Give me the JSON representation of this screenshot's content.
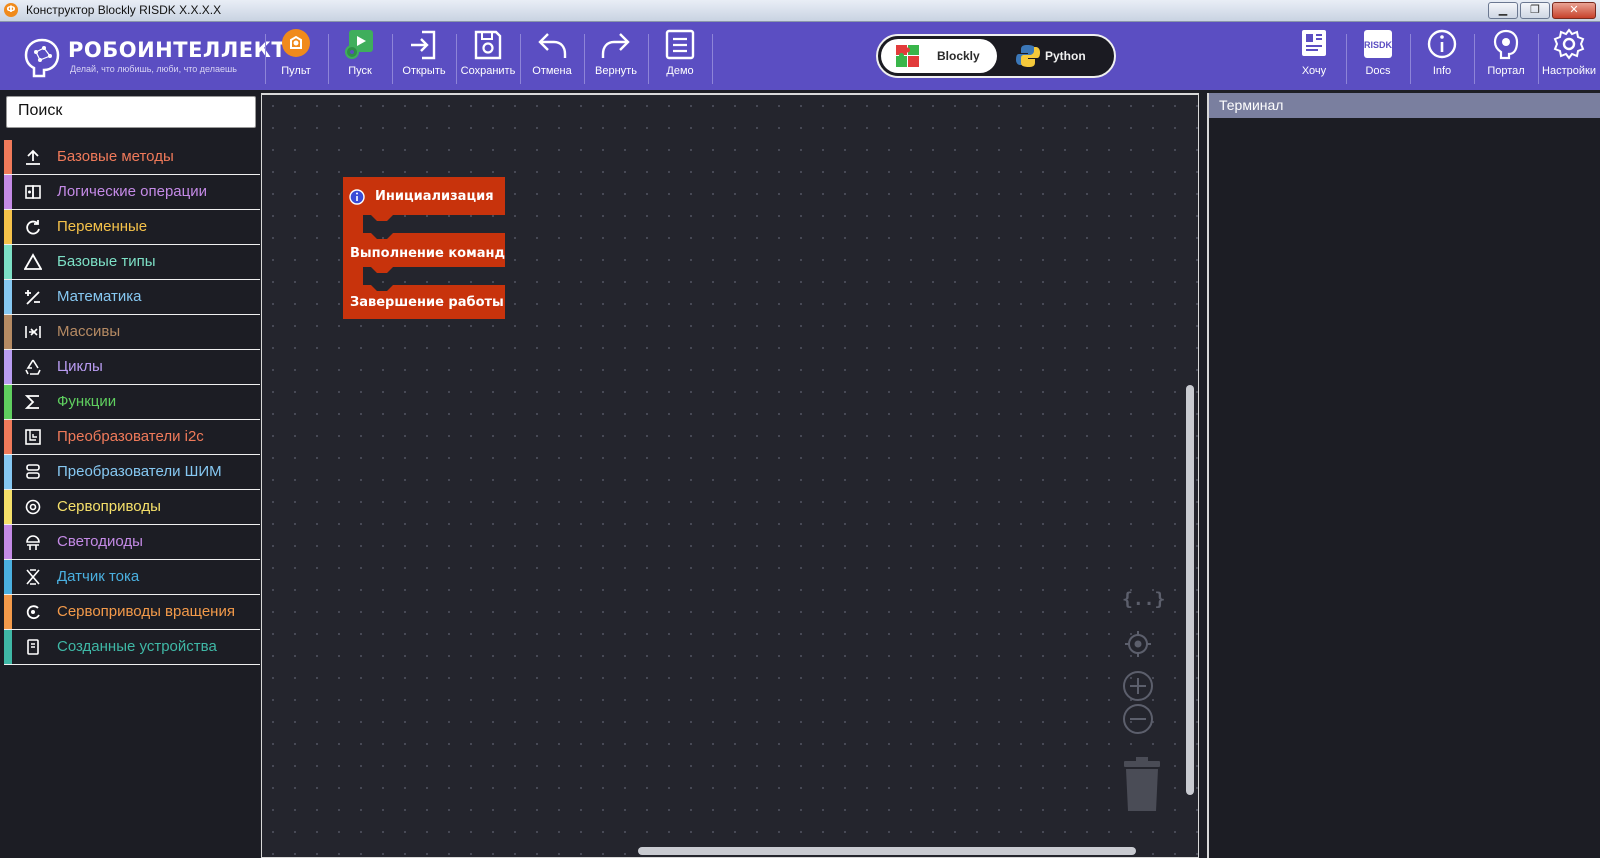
{
  "window": {
    "title": "Конструктор Blockly RISDK X.X.X.X",
    "minimize": "▁",
    "maximize": "❐",
    "close": "✕"
  },
  "logo": {
    "name": "РОБОИНТЕЛЛЕКТ",
    "slogan": "Делай, что любишь, люби, что делаешь"
  },
  "toolbar": {
    "buttons": [
      {
        "label": "Пульт",
        "icon": "remote-icon"
      },
      {
        "label": "Пуск",
        "icon": "run-icon"
      },
      {
        "label": "Открыть",
        "icon": "open-icon"
      },
      {
        "label": "Сохранить",
        "icon": "save-icon"
      },
      {
        "label": "Отмена",
        "icon": "undo-icon"
      },
      {
        "label": "Вернуть",
        "icon": "redo-icon"
      },
      {
        "label": "Демо",
        "icon": "demo-icon"
      }
    ],
    "right_buttons": [
      {
        "label": "Хочу",
        "icon": "wish-icon"
      },
      {
        "label": "Docs",
        "icon": "docs-icon",
        "badge": "RISDK"
      },
      {
        "label": "Info",
        "icon": "info-icon"
      },
      {
        "label": "Портал",
        "icon": "portal-icon"
      },
      {
        "label": "Настройки",
        "icon": "settings-icon"
      }
    ],
    "modes": {
      "blockly": "Blockly",
      "python": "Python",
      "active": "Blockly"
    }
  },
  "sidebar": {
    "search_text": "Поиск",
    "categories": [
      {
        "label": "Базовые методы",
        "color": "#f07a5a",
        "icon": "upload-icon"
      },
      {
        "label": "Логические операции",
        "color": "#c48ae6",
        "icon": "logic-icon"
      },
      {
        "label": "Переменные",
        "color": "#f5c24a",
        "icon": "variables-icon"
      },
      {
        "label": "Базовые типы",
        "color": "#7de0c6",
        "icon": "triangle-icon"
      },
      {
        "label": "Математика",
        "color": "#86c8f2",
        "icon": "math-icon"
      },
      {
        "label": "Массивы",
        "color": "#b58a63",
        "icon": "arrays-icon"
      },
      {
        "label": "Циклы",
        "color": "#b99cf2",
        "icon": "loops-icon"
      },
      {
        "label": "Функции",
        "color": "#5fcf5f",
        "icon": "sigma-icon"
      },
      {
        "label": "Преобразователи i2c",
        "color": "#f07a5a",
        "icon": "i2c-icon"
      },
      {
        "label": "Преобразователи ШИМ",
        "color": "#86c8f2",
        "icon": "pwm-icon"
      },
      {
        "label": "Сервоприводы",
        "color": "#f5e06a",
        "icon": "servo-icon"
      },
      {
        "label": "Светодиоды",
        "color": "#c48ae6",
        "icon": "led-icon"
      },
      {
        "label": "Датчик тока",
        "color": "#4ab0e0",
        "icon": "current-sensor-icon"
      },
      {
        "label": "Сервоприводы вращения",
        "color": "#f39a4a",
        "icon": "rotation-servo-icon"
      },
      {
        "label": "Созданные устройства",
        "color": "#3fb8a6",
        "icon": "device-icon"
      }
    ]
  },
  "workspace": {
    "block": {
      "color": "#c8330c",
      "sections": [
        "Инициализация",
        "Выполнение команд",
        "Завершение работы"
      ]
    },
    "controls": {
      "code": "{..}"
    }
  },
  "terminal": {
    "title": "Терминал"
  }
}
